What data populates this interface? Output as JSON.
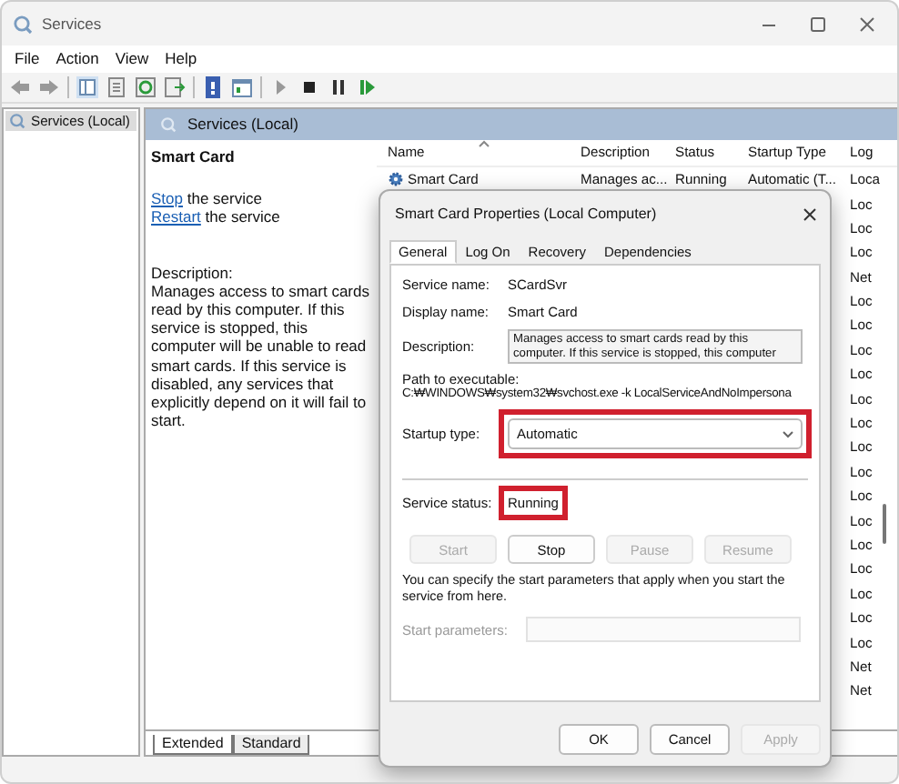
{
  "window": {
    "title": "Services"
  },
  "menu": [
    "File",
    "Action",
    "View",
    "Help"
  ],
  "tree": [
    {
      "label": "Services (Local)",
      "selected": true
    }
  ],
  "panel": {
    "header": "Services (Local)"
  },
  "extended": {
    "title": "Smart Card",
    "actions": [
      {
        "link": "Stop",
        "text": " the service"
      },
      {
        "link": "Restart",
        "text": " the service"
      }
    ],
    "description_label": "Description:",
    "description": "Manages access to smart cards read by this computer. If this service is stopped, this computer will be unable to read smart cards. If this service is disabled, any services that explicitly depend on it will fail to start."
  },
  "list": {
    "columns": [
      "Name",
      "Description",
      "Status",
      "Startup Type",
      "Log"
    ],
    "rows": [
      {
        "name": "Smart Card",
        "description": "Manages ac...",
        "status": "Running",
        "startup_type": "Automatic (T...",
        "log": "Loca"
      },
      {
        "log": "Loc"
      },
      {
        "log": "Loc"
      },
      {
        "log": "Loc"
      },
      {
        "log": "Net"
      },
      {
        "log": "Loc"
      },
      {
        "log": "Loc"
      },
      {
        "log": "Loc"
      },
      {
        "log": "Loc"
      },
      {
        "log": "Loc"
      },
      {
        "log": "Loc"
      },
      {
        "log": "Loc"
      },
      {
        "log": "Loc"
      },
      {
        "log": "Loc"
      },
      {
        "log": "Loc"
      },
      {
        "log": "Loc"
      },
      {
        "log": "Loc"
      },
      {
        "log": "Loc"
      },
      {
        "log": "Loc"
      },
      {
        "log": "Loc"
      },
      {
        "log": "Net"
      },
      {
        "log": "Net"
      }
    ]
  },
  "view_tabs": [
    {
      "label": "Extended",
      "selected": true
    },
    {
      "label": "Standard",
      "selected": false
    }
  ],
  "dialog": {
    "title": "Smart Card Properties (Local Computer)",
    "tabs": [
      {
        "label": "General",
        "selected": true
      },
      {
        "label": "Log On",
        "selected": false
      },
      {
        "label": "Recovery",
        "selected": false
      },
      {
        "label": "Dependencies",
        "selected": false
      }
    ],
    "service_name": {
      "label": "Service name:",
      "value": "SCardSvr"
    },
    "display_name": {
      "label": "Display name:",
      "value": "Smart Card"
    },
    "description": {
      "label": "Description:",
      "value": "Manages access to smart cards read by this computer. If this service is stopped, this computer"
    },
    "path": {
      "label": "Path to executable:",
      "value": "C:₩WINDOWS₩system32₩svchost.exe -k LocalServiceAndNoImpersona"
    },
    "startup_type": {
      "label": "Startup type:",
      "value": "Automatic",
      "highlighted": true
    },
    "service_status": {
      "label": "Service status:",
      "value": "Running",
      "highlighted": true
    },
    "service_buttons": [
      {
        "label": "Start",
        "disabled": true
      },
      {
        "label": "Stop",
        "disabled": false
      },
      {
        "label": "Pause",
        "disabled": true
      },
      {
        "label": "Resume",
        "disabled": true
      }
    ],
    "hint": "You can specify the start parameters that apply when you start the service from here.",
    "start_parameters": {
      "label": "Start parameters:",
      "disabled": true
    },
    "buttons": [
      {
        "label": "OK",
        "disabled": false
      },
      {
        "label": "Cancel",
        "disabled": false
      },
      {
        "label": "Apply",
        "disabled": true
      }
    ]
  }
}
